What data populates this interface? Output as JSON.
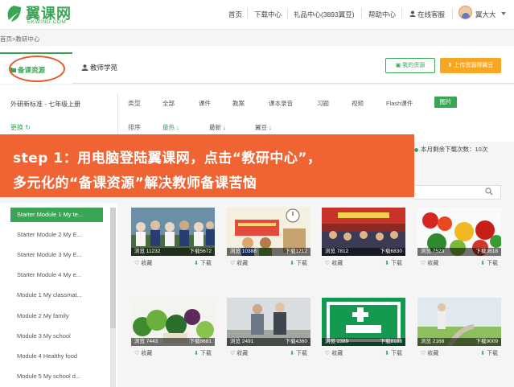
{
  "header": {
    "logo_text": "翼课网",
    "logo_sub": "EKWING.COM",
    "nav": [
      "首页",
      "下载中心",
      "礼品中心(3893翼豆)",
      "帮助中心",
      "在线客服"
    ],
    "user": "翼大大"
  },
  "breadcrumb": {
    "home": "首页>",
    "current": "教研中心"
  },
  "tabs": {
    "active": "备课资源",
    "inactive": "教师学苑"
  },
  "buttons": {
    "my_resources": "我的资源",
    "upload": "上传资源得翼豆"
  },
  "filters": {
    "textbook": "外研新标准 - 七年级上册",
    "change": "更换",
    "type_label": "类型",
    "types": [
      "全部",
      "课件",
      "教案",
      "课本录音",
      "习题",
      "视频",
      "Flash课件",
      "图片"
    ],
    "sort_label": "排序",
    "sorts": [
      "最热",
      "最新",
      "翼豆"
    ]
  },
  "banner": {
    "line1": "step 1：用电脑登陆翼课网，点击“教研中心”，",
    "line2": "多元化的“备课资源”解决教师备课苦恼"
  },
  "quota": "本月剩余下载次数：10次",
  "modules": [
    "Starter Module 1 My te...",
    "Starter Module 2 My E...",
    "Starter Module 3 My E...",
    "Starter Module 4 My e...",
    "Module 1 My classmat...",
    "Module 2 My family",
    "Module 3 My school",
    "Module 4 Healthy food",
    "Module 5 My school d..."
  ],
  "cards": [
    {
      "views": "浏览 11232",
      "downloads": "下载5672"
    },
    {
      "views": "浏览 10388",
      "downloads": "下载1212"
    },
    {
      "views": "浏览 7812",
      "downloads": "下载6830"
    },
    {
      "views": "浏览 7523",
      "downloads": "下载3618"
    },
    {
      "views": "浏览 7443",
      "downloads": "下载8681"
    },
    {
      "views": "浏览 2491",
      "downloads": "下载4360"
    },
    {
      "views": "浏览 2389",
      "downloads": "下载8188"
    },
    {
      "views": "浏览 2168",
      "downloads": "下载9009"
    }
  ],
  "card_actions": {
    "fav": "收藏",
    "download": "下载"
  },
  "colors": {
    "brand_green": "#3aa655",
    "banner_orange": "#f06434",
    "upload_orange": "#f5a623"
  }
}
